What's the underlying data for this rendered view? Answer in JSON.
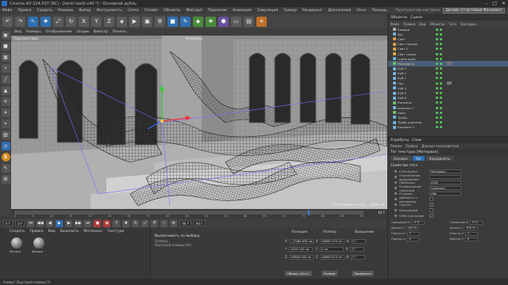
{
  "window": {
    "title": "Cinema 4D S24.037 (RC) - [kentí textil.c4d *] - Основной дубль",
    "controls": [
      "–",
      "□",
      "✕"
    ]
  },
  "menubar": {
    "items": [
      "Файл",
      "Правка",
      "Создать",
      "Режимы",
      "Выбор",
      "Инструменты",
      "Сетка",
      "Сплайн",
      "Объекты",
      "MoGraph",
      "Персонаж",
      "Анимация",
      "Симуляция",
      "Трекер",
      "Рендеринг",
      "Дополнения",
      "Окно",
      "Помощь"
    ],
    "layout_label": "Пространство настроек:",
    "layout_value": "Дизайн (стартовый Феномен)"
  },
  "toolbar": {
    "icons": [
      {
        "name": "undo-icon",
        "glyph": "↶",
        "tone": ""
      },
      {
        "name": "redo-icon",
        "glyph": "↷",
        "tone": ""
      },
      {
        "name": "select-icon",
        "glyph": "↖",
        "tone": "blue"
      },
      {
        "name": "move-icon",
        "glyph": "✚",
        "tone": "blue"
      },
      {
        "name": "scale-icon",
        "glyph": "⤢",
        "tone": ""
      },
      {
        "name": "rotate-icon",
        "glyph": "↻",
        "tone": ""
      },
      {
        "name": "axis-x-icon",
        "glyph": "X",
        "tone": ""
      },
      {
        "name": "axis-y-icon",
        "glyph": "Y",
        "tone": ""
      },
      {
        "name": "axis-z-icon",
        "glyph": "Z",
        "tone": ""
      },
      {
        "name": "coords-icon",
        "glyph": "◈",
        "tone": ""
      },
      {
        "name": "render-view-icon",
        "glyph": "▶",
        "tone": ""
      },
      {
        "name": "render-picture-icon",
        "glyph": "▣",
        "tone": ""
      },
      {
        "name": "render-settings-icon",
        "glyph": "⚙",
        "tone": ""
      },
      {
        "name": "cube-icon",
        "glyph": "■",
        "tone": "blue"
      },
      {
        "name": "pen-icon",
        "glyph": "✎",
        "tone": "blue"
      },
      {
        "name": "subdivision-icon",
        "glyph": "◆",
        "tone": "green"
      },
      {
        "name": "cloner-icon",
        "glyph": "❖",
        "tone": "green"
      },
      {
        "name": "deformer-icon",
        "glyph": "⬢",
        "tone": "purple"
      },
      {
        "name": "floor-icon",
        "glyph": "▭",
        "tone": ""
      },
      {
        "name": "camera-icon",
        "glyph": "▤",
        "tone": ""
      },
      {
        "name": "light-icon",
        "glyph": "☀",
        "tone": "orange"
      }
    ]
  },
  "left_tools": [
    {
      "name": "make-editable-icon",
      "glyph": "▣",
      "tone": ""
    },
    {
      "name": "model-mode-icon",
      "glyph": "■",
      "tone": ""
    },
    {
      "name": "texture-mode-icon",
      "glyph": "▩",
      "tone": ""
    },
    {
      "name": "points-mode-icon",
      "glyph": "•",
      "tone": ""
    },
    {
      "name": "edges-mode-icon",
      "glyph": "╱",
      "tone": ""
    },
    {
      "name": "polygons-mode-icon",
      "glyph": "▲",
      "tone": ""
    },
    {
      "name": "axis-mode-icon",
      "glyph": "✛",
      "tone": ""
    },
    {
      "name": "tweak-icon",
      "glyph": "✶",
      "tone": ""
    },
    {
      "name": "snap-icon",
      "glyph": "⌖",
      "tone": ""
    },
    {
      "name": "lock-workplane-icon",
      "glyph": "▧",
      "tone": ""
    },
    {
      "name": "solo-icon",
      "glyph": "◎",
      "tone": "blue"
    },
    {
      "name": "sketch-icon",
      "glyph": "S",
      "tone": "s"
    },
    {
      "name": "paint-icon",
      "glyph": "✎",
      "tone": ""
    },
    {
      "name": "python-icon",
      "glyph": "⌘",
      "tone": ""
    }
  ],
  "viewport": {
    "menu": [
      "Вид",
      "Камеры",
      "Отображение",
      "Опции",
      "Фильтр",
      "Панель"
    ],
    "view_label": "Перспектива",
    "camera_label": "Камера ▸",
    "grid_label": "Расстояние сетки : 1000 см"
  },
  "timeline": {
    "ticks": [
      "0",
      "5",
      "10",
      "15",
      "20",
      "25",
      "30",
      "35",
      "40",
      "45",
      "50",
      "55",
      "60",
      "65",
      "70",
      "75",
      "80",
      "85",
      "90"
    ],
    "current_fraction": 0.84,
    "end_label": "84 F"
  },
  "playback": {
    "start": "0 F",
    "current": "0 F",
    "end": "90 F",
    "end2": "90 F",
    "buttons": [
      {
        "name": "goto-start-button",
        "glyph": "⏮",
        "tone": ""
      },
      {
        "name": "prev-key-button",
        "glyph": "◀◀",
        "tone": ""
      },
      {
        "name": "prev-frame-button",
        "glyph": "◀",
        "tone": ""
      },
      {
        "name": "play-button",
        "glyph": "▶",
        "tone": "active"
      },
      {
        "name": "next-frame-button",
        "glyph": "▶",
        "tone": ""
      },
      {
        "name": "next-key-button",
        "glyph": "▶▶",
        "tone": ""
      },
      {
        "name": "goto-end-button",
        "glyph": "⏭",
        "tone": ""
      },
      {
        "name": "record-button",
        "glyph": "●",
        "tone": "red"
      },
      {
        "name": "autokey-button",
        "glyph": "◉",
        "tone": "red"
      },
      {
        "name": "keyframe-button",
        "glyph": "?",
        "tone": ""
      },
      {
        "name": "move-key-button",
        "glyph": "✚",
        "tone": ""
      },
      {
        "name": "rotate-key-button",
        "glyph": "↻",
        "tone": ""
      },
      {
        "name": "scale-key-button",
        "glyph": "⤢",
        "tone": ""
      },
      {
        "name": "param-key-button",
        "glyph": "P",
        "tone": ""
      },
      {
        "name": "point-key-button",
        "glyph": "∷",
        "tone": ""
      },
      {
        "name": "timeline-layout-button",
        "glyph": "≡",
        "tone": ""
      }
    ]
  },
  "materials": {
    "menu": [
      "Создать",
      "Правка",
      "Вид",
      "Выделить",
      "Материал",
      "Текстура"
    ],
    "items": [
      "Матери",
      "Матери"
    ]
  },
  "hint": {
    "title": "Высвечивать по выбору",
    "sub": "Отмена",
    "key": "(Быстрый клавиш Alt)"
  },
  "coords": {
    "head_position": "Позиция",
    "head_size": "Размер",
    "head_rotation": "Вращение",
    "rows": [
      {
        "axis": "X",
        "pos": "-17484.634 см",
        "size_axis": "X",
        "size": "34885.475 см",
        "rot_axis": "H",
        "rot": "0 °"
      },
      {
        "axis": "Y",
        "pos": "4220.132 см",
        "size_axis": "Y",
        "size": "0 см",
        "rot_axis": "P",
        "rot": "0 °"
      },
      {
        "axis": "Z",
        "pos": "18845.405 см",
        "size_axis": "Z",
        "size": "34885.475 см",
        "rot_axis": "B",
        "rot": "0 °"
      }
    ],
    "mode": "Объект (Отн.)",
    "size_mode": "Размер",
    "apply": "Применить"
  },
  "status": "Азимут (Быстрый клавиш Y)",
  "object_manager": {
    "tabs": [
      "Объекты",
      "Сцена"
    ],
    "menu": [
      "Файл",
      "Правка",
      "Вид",
      "Объекты",
      "Теги",
      "Закладки"
    ],
    "rows": [
      {
        "name": "Камера",
        "icon": "w",
        "selected": false,
        "tag": false
      },
      {
        "name": "Sky",
        "icon": "",
        "selected": false,
        "tag": false
      },
      {
        "name": "Свет",
        "icon": "o",
        "selected": false,
        "tag": false
      },
      {
        "name": "Свет солнца",
        "icon": "o",
        "selected": false,
        "tag": false
      },
      {
        "name": "Свет 2",
        "icon": "o",
        "selected": false,
        "tag": false
      },
      {
        "name": "Свет сцены",
        "icon": "o",
        "selected": false,
        "tag": false
      },
      {
        "name": "сцена арки",
        "icon": "",
        "selected": false,
        "tag": false
      },
      {
        "name": "Плоскость",
        "icon": "g",
        "selected": true,
        "tag": true
      },
      {
        "name": "Куб 3",
        "icon": "",
        "selected": false,
        "tag": false
      },
      {
        "name": "Куб 2",
        "icon": "",
        "selected": false,
        "tag": false
      },
      {
        "name": "Куб 1",
        "icon": "",
        "selected": false,
        "tag": false
      },
      {
        "name": "Пол",
        "icon": "",
        "selected": false,
        "tag": true
      },
      {
        "name": "Куб 4",
        "icon": "",
        "selected": false,
        "tag": false
      },
      {
        "name": "Куб 5",
        "icon": "",
        "selected": false,
        "tag": false
      },
      {
        "name": "Куб 6",
        "icon": "",
        "selected": false,
        "tag": false
      },
      {
        "name": "Колонны",
        "icon": "g",
        "selected": false,
        "tag": false
      },
      {
        "name": "колонна 1",
        "icon": "",
        "selected": false,
        "tag": false
      },
      {
        "name": "Арки",
        "icon": "g",
        "selected": false,
        "tag": false
      },
      {
        "name": "Труба",
        "icon": "",
        "selected": false,
        "tag": false
      },
      {
        "name": "Труба длинная",
        "icon": "",
        "selected": false,
        "tag": false
      },
      {
        "name": "Колонна 3",
        "icon": "",
        "selected": false,
        "tag": false
      }
    ]
  },
  "attributes": {
    "tabs": [
      "Атрибуты",
      "Слои"
    ],
    "menu": [
      "Режим",
      "Правка",
      "Данные пользователя"
    ],
    "title": "Тег текстуры [Материал]",
    "subtabs": [
      "Базовые",
      "Тег",
      "Координаты"
    ],
    "section": "Свойства тега",
    "rows": [
      {
        "label": "▸ Материал",
        "value": "Материал",
        "type": "field"
      },
      {
        "label": "Ограничение выделением",
        "value": "",
        "type": "field"
      },
      {
        "label": "Проекция",
        "value": "UVW",
        "type": "field"
      },
      {
        "label": "Отображение проекции",
        "value": "Симплекс",
        "type": "field"
      },
      {
        "label": "Сторона",
        "value": "Обе",
        "type": "field"
      },
      {
        "label": "Добавить к материалу",
        "value": "",
        "type": "check"
      },
      {
        "label": "Плитка",
        "value": "✓",
        "type": "check"
      },
      {
        "label": "Бесшовный",
        "value": "",
        "type": "check"
      },
      {
        "label": "UVW в рельефе",
        "value": "✓",
        "type": "check"
      }
    ],
    "grid": [
      {
        "label": "Смещение U",
        "value": "0 %"
      },
      {
        "label": "Смещение V",
        "value": "0 %"
      },
      {
        "label": "Длина U",
        "value": "100 %"
      },
      {
        "label": "Длина V",
        "value": "100 %"
      },
      {
        "label": "Плитка U",
        "value": "1"
      },
      {
        "label": "Плитка V",
        "value": "1"
      },
      {
        "label": "Повтор U",
        "value": "0"
      },
      {
        "label": "Повтор V",
        "value": "0"
      }
    ]
  },
  "colors": {
    "accent": "#2f6fb0",
    "selection": "#4b5f7a",
    "viewport_bg": "#8e8e8e"
  }
}
